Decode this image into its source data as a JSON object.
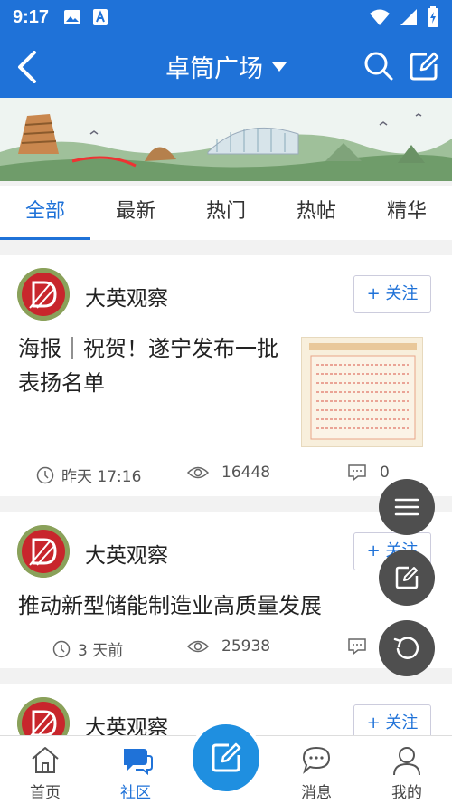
{
  "status_bar": {
    "time": "9:17"
  },
  "header": {
    "title": "卓筒广场"
  },
  "tabs": [
    {
      "label": "全部",
      "active": true
    },
    {
      "label": "最新"
    },
    {
      "label": "热门"
    },
    {
      "label": "热帖"
    },
    {
      "label": "精华"
    }
  ],
  "posts": [
    {
      "author": "大英观察",
      "follow_label": "+ 关注",
      "title": "海报｜祝贺！遂宁发布一批表扬名单",
      "time": "昨天 17:16",
      "views": "16448",
      "comments": "0"
    },
    {
      "author": "大英观察",
      "follow_label": "+ 关注",
      "title": "推动新型储能制造业高质量发展",
      "time": "3 天前",
      "views": "25938",
      "comments": "0"
    },
    {
      "author": "大英观察",
      "follow_label": "+ 关注"
    }
  ],
  "bottom_nav": [
    {
      "label": "首页",
      "icon": "home-icon"
    },
    {
      "label": "社区",
      "icon": "community-icon",
      "active": true
    },
    {
      "label": "",
      "icon": "compose-icon"
    },
    {
      "label": "消息",
      "icon": "message-icon"
    },
    {
      "label": "我的",
      "icon": "profile-icon"
    }
  ],
  "colors": {
    "primary": "#1f72d8",
    "fab": "#4f4f4f",
    "center_button": "#1f8fe0"
  }
}
